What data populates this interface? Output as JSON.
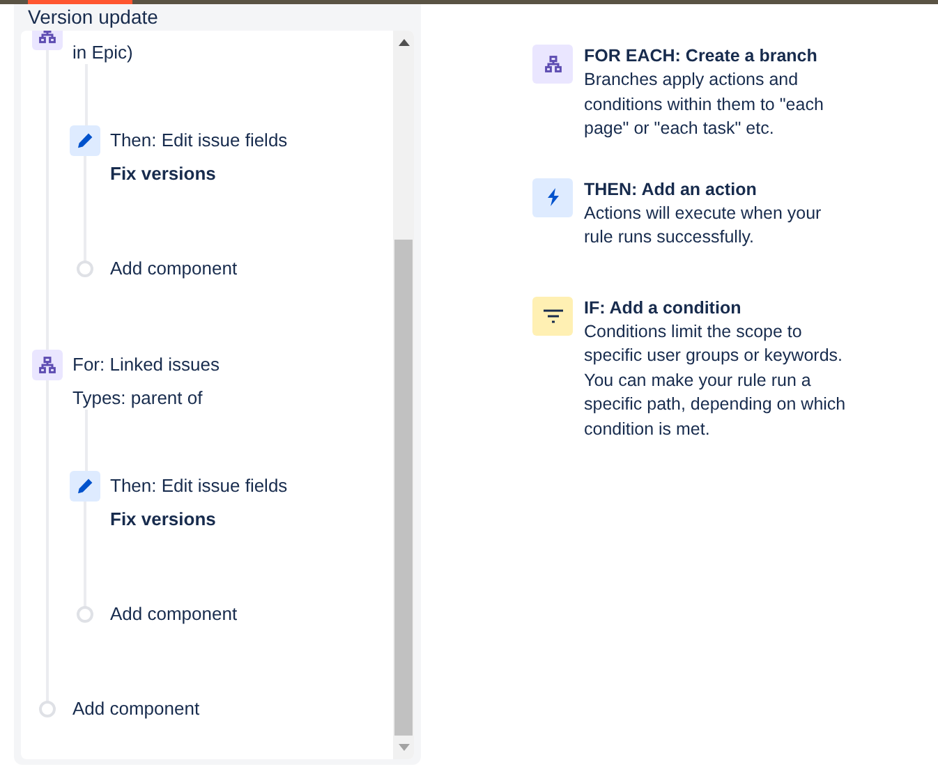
{
  "rule": {
    "title": "Version update",
    "components": [
      {
        "kind": "branch",
        "title": "in Epic)",
        "children": [
          {
            "kind": "action",
            "title": "Then: Edit issue fields",
            "detail": "Fix versions"
          },
          {
            "kind": "add",
            "title": "Add component"
          }
        ]
      },
      {
        "kind": "branch",
        "title": "For: Linked issues",
        "detail": "Types: parent of",
        "children": [
          {
            "kind": "action",
            "title": "Then: Edit issue fields",
            "detail": "Fix versions"
          },
          {
            "kind": "add",
            "title": "Add component"
          }
        ]
      },
      {
        "kind": "add",
        "title": "Add component"
      }
    ]
  },
  "help": [
    {
      "kind": "branch",
      "title": "FOR EACH: Create a branch",
      "description": "Branches apply actions and conditions within them to \"each page\" or \"each task\" etc."
    },
    {
      "kind": "action",
      "title": "THEN: Add an action",
      "description": "Actions will execute when your rule runs successfully."
    },
    {
      "kind": "condition",
      "title": "IF: Add a condition",
      "description": "Conditions limit the scope to specific user groups or keywords. You can make your rule run a specific path, depending on which condition is met."
    }
  ]
}
